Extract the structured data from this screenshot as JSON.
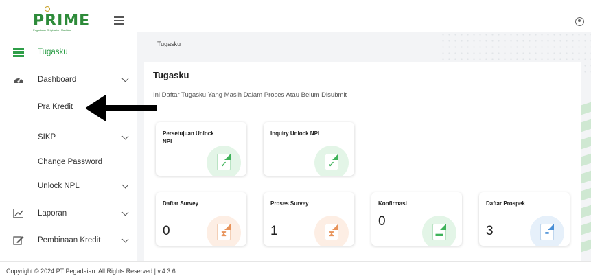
{
  "app": {
    "logo_text": "PRIME",
    "logo_subtitle": "Pegadaian Origination Machine"
  },
  "sidebar": {
    "items": [
      {
        "label": "Tugasku",
        "icon": "list-icon",
        "active": true
      },
      {
        "label": "Dashboard",
        "icon": "speedometer-icon",
        "expandable": true
      },
      {
        "label": "Pra Kredit"
      },
      {
        "label": "SIKP",
        "expandable": true
      },
      {
        "label": "Change Password"
      },
      {
        "label": "Unlock NPL",
        "expandable": true
      },
      {
        "label": "Laporan",
        "icon": "chart-line-icon",
        "expandable": true
      },
      {
        "label": "Pembinaan Kredit",
        "icon": "edit-icon",
        "expandable": true
      }
    ]
  },
  "breadcrumb": "Tugasku",
  "panel": {
    "title": "Tugasku",
    "subtitle": "Ini Daftar Tugasku Yang Masih Dalam Proses Atau Belum Disubmit"
  },
  "cards": [
    {
      "title": "Persetujuan Unlock NPL",
      "count": "",
      "icon": "check-document-icon",
      "tone": "green"
    },
    {
      "title": "Inquiry Unlock NPL",
      "count": "",
      "icon": "check-document-icon",
      "tone": "green"
    },
    {
      "title": "Daftar Survey",
      "count": "0",
      "icon": "hourglass-document-icon",
      "tone": "orange"
    },
    {
      "title": "Proses Survey",
      "count": "1",
      "icon": "hourglass-document-icon",
      "tone": "orange"
    },
    {
      "title": "Konfirmasi",
      "count": "0",
      "icon": "message-document-icon",
      "tone": "green"
    },
    {
      "title": "Daftar Prospek",
      "count": "3",
      "icon": "list-document-icon",
      "tone": "blue"
    }
  ],
  "footer": "Copyright © 2024 PT Pegadaian. All Rights Reserved | v.4.3.6",
  "colors": {
    "brand": "#2e8b3a",
    "active": "#2e9e48",
    "green_badge": "#e3f5e7",
    "orange_badge": "#fdeee4",
    "blue_badge": "#e6f0fa"
  }
}
